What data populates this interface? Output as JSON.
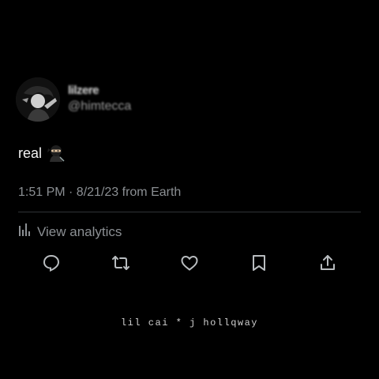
{
  "profile": {
    "display_name": "lilzere",
    "handle": "@himtecca"
  },
  "tweet": {
    "text": "real",
    "emoji": "ninja-emoji",
    "meta": "1:51 PM · 8/21/23 from Earth"
  },
  "analytics": {
    "label": "View analytics",
    "icon": "bar-chart-icon"
  },
  "actions": [
    {
      "name": "reply",
      "icon": "comment-icon"
    },
    {
      "name": "retweet",
      "icon": "retweet-icon"
    },
    {
      "name": "like",
      "icon": "heart-icon"
    },
    {
      "name": "bookmark",
      "icon": "bookmark-icon"
    },
    {
      "name": "share",
      "icon": "share-icon"
    }
  ],
  "credit": "lil cai * j hollqway",
  "colors": {
    "background": "#000000",
    "text": "#e7e9ea",
    "muted": "#8b8f93",
    "divider": "#2f3336"
  }
}
